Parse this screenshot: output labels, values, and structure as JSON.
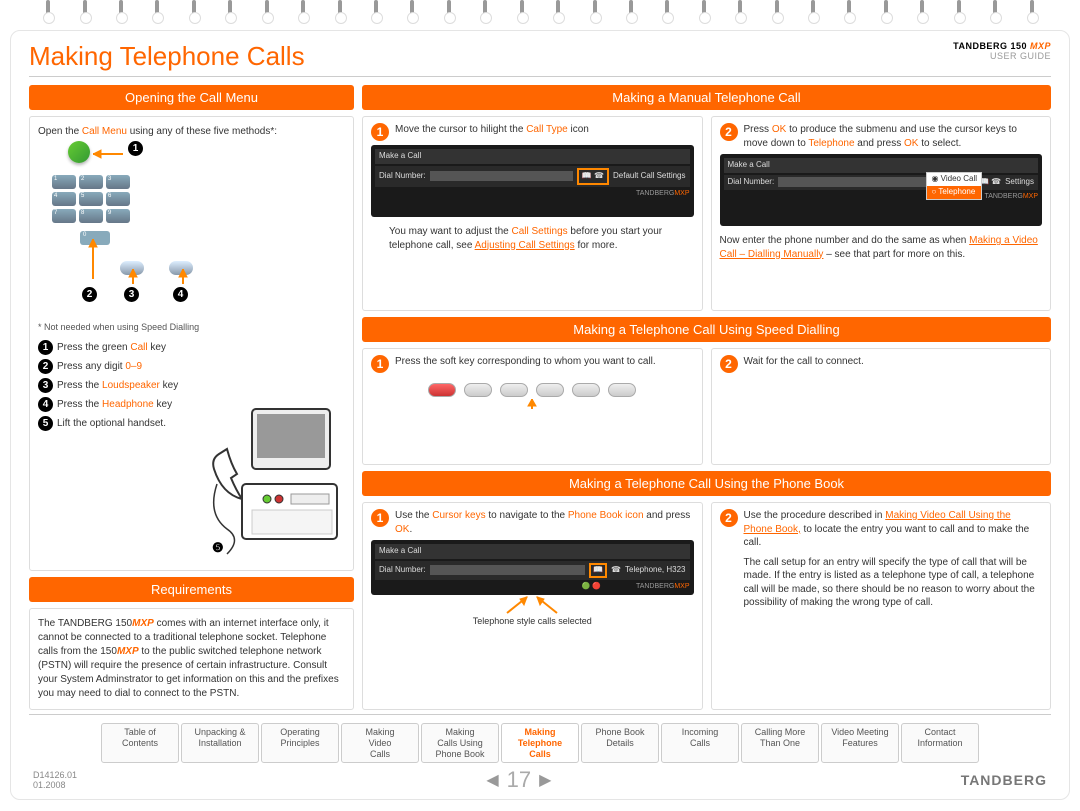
{
  "header": {
    "brand": "TANDBERG 150",
    "model": "MXP",
    "subtitle": "USER GUIDE"
  },
  "title": "Making Telephone Calls",
  "sections": {
    "opening": {
      "title": "Opening the Call Menu",
      "intro_a": "Open the ",
      "intro_b": "Call Menu",
      "intro_c": " using any of these five methods*:",
      "footnote": "* Not needed when using Speed Dialling",
      "steps": {
        "s1a": "Press the green ",
        "s1b": "Call",
        "s1c": " key",
        "s2a": "Press any digit ",
        "s2b": "0–9",
        "s3a": "Press the ",
        "s3b": "Loudspeaker",
        "s3c": " key",
        "s4a": "Press the ",
        "s4b": "Headphone",
        "s4c": " key",
        "s5a": "Lift the optional handset."
      }
    },
    "requirements": {
      "title": "Requirements",
      "body_a": "The TANDBERG 150",
      "body_b": "MXP",
      "body_c": " comes with an internet interface only, it cannot be connected to a traditional telephone socket. Telephone calls from the 150",
      "body_d": "MXP",
      "body_e": " to the public switched telephone network (PSTN) will require the presence of certain infrastructure. Consult your System Adminstrator to get information on this and the prefixes you may need to dial to connect to the PSTN."
    },
    "manual": {
      "title": "Making a Manual Telephone Call",
      "box1_a": "Move the cursor to hilight the ",
      "box1_b": "Call Type",
      "box1_c": " icon",
      "note_a": "You may want to adjust the ",
      "note_b": "Call Settings",
      "note_c": " before you start your telephone call, see ",
      "note_link": "Adjusting Call Settings",
      "note_d": " for more.",
      "box2_a": "Press ",
      "box2_b": "OK",
      "box2_c": " to produce the submenu and use the cursor keys to move down to ",
      "box2_d": "Telephone",
      "box2_e": " and press ",
      "box2_f": "OK",
      "box2_g": " to select.",
      "box2_after_a": "Now enter the phone number and do the same as when ",
      "box2_link": "Making a Video Call – Dialling Manually",
      "box2_after_b": " – see that part for more on this."
    },
    "speed": {
      "title": "Making a Telephone Call Using Speed Dialling",
      "box1": "Press the soft key corresponding to whom you want to call.",
      "box2": "Wait for the call to connect."
    },
    "phonebook": {
      "title": "Making a Telephone Call Using the Phone Book",
      "box1_a": "Use the ",
      "box1_b": "Cursor keys",
      "box1_c": " to navigate to the ",
      "box1_d": "Phone Book icon",
      "box1_e": " and press ",
      "box1_f": "OK",
      "box1_g": ".",
      "caption": "Telephone style calls selected",
      "box2_a": "Use the procedure described in ",
      "box2_link": "Making Video Call Using the Phone Book,",
      "box2_b": " to locate the entry you want to call and to make the call.",
      "box2_c": "The call setup for an entry will specify the type of call that will be made. If the entry is listed as a telephone type of call, a telephone call will be made, so there should be no reason to worry about the possibility of making the wrong type of call."
    }
  },
  "device_ui": {
    "make_call": "Make a Call",
    "dial_number": "Dial Number:",
    "default_settings": "Default Call Settings",
    "settings": "Settings",
    "video_call": "Video Call",
    "telephone": "Telephone",
    "telephone_h323": "Telephone, H323",
    "brand": "TANDBERG",
    "brand_m": "MXP"
  },
  "nav": {
    "n1a": "Table of",
    "n1b": "Contents",
    "n2a": "Unpacking &",
    "n2b": "Installation",
    "n3a": "Operating",
    "n3b": "Principles",
    "n4a": "Making",
    "n4b": "Video",
    "n4c": "Calls",
    "n5a": "Making",
    "n5b": "Calls Using",
    "n5c": "Phone Book",
    "n6a": "Making",
    "n6b": "Telephone",
    "n6c": "Calls",
    "n7a": "Phone Book",
    "n7b": "Details",
    "n8a": "Incoming",
    "n8b": "Calls",
    "n9a": "Calling More",
    "n9b": "Than One",
    "n10a": "Video Meeting",
    "n10b": "Features",
    "n11a": "Contact",
    "n11b": "Information"
  },
  "footer": {
    "doc": "D14126.01",
    "date": "01.2008",
    "page": "17",
    "logo": "TANDBERG"
  }
}
